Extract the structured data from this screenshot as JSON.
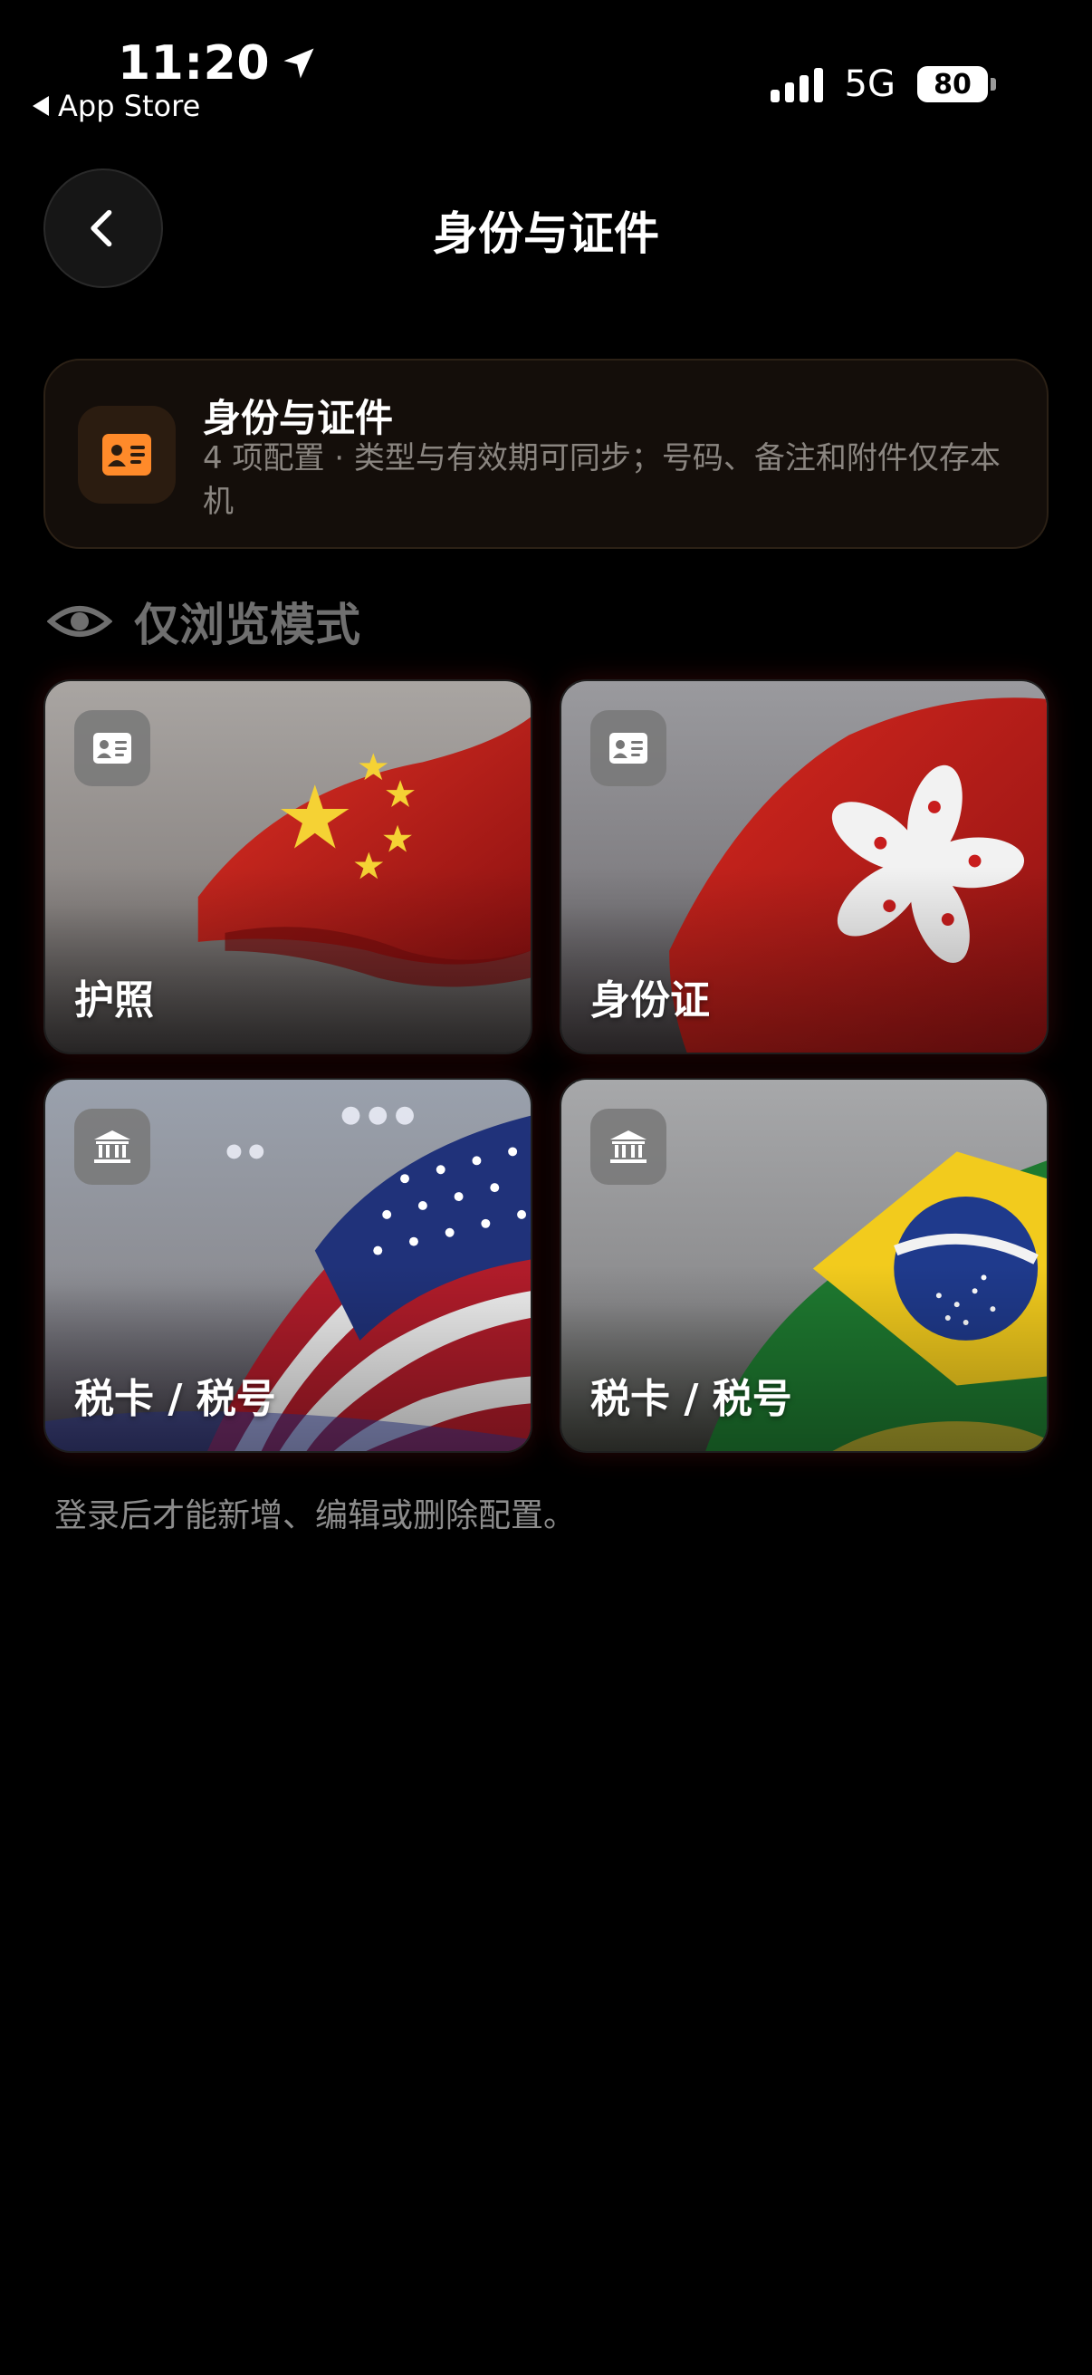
{
  "status_bar": {
    "time": "11:20",
    "back_app": "App Store",
    "network": "5G",
    "battery": "80"
  },
  "header": {
    "title": "身份与证件"
  },
  "info_card": {
    "title": "身份与证件",
    "description": "4 项配置 · 类型与有效期可同步；号码、备注和附件仅存本机",
    "accent_color": "#ff8a2a"
  },
  "browse_mode": {
    "label": "仅浏览模式"
  },
  "cards": [
    {
      "label": "护照",
      "icon": "id-card-icon",
      "flag": "china"
    },
    {
      "label": "身份证",
      "icon": "id-card-icon",
      "flag": "hong-kong"
    },
    {
      "label": "税卡 / 税号",
      "icon": "bank-icon",
      "flag": "usa"
    },
    {
      "label": "税卡 / 税号",
      "icon": "bank-icon",
      "flag": "brazil"
    }
  ],
  "footer_note": "登录后才能新增、编辑或删除配置。"
}
